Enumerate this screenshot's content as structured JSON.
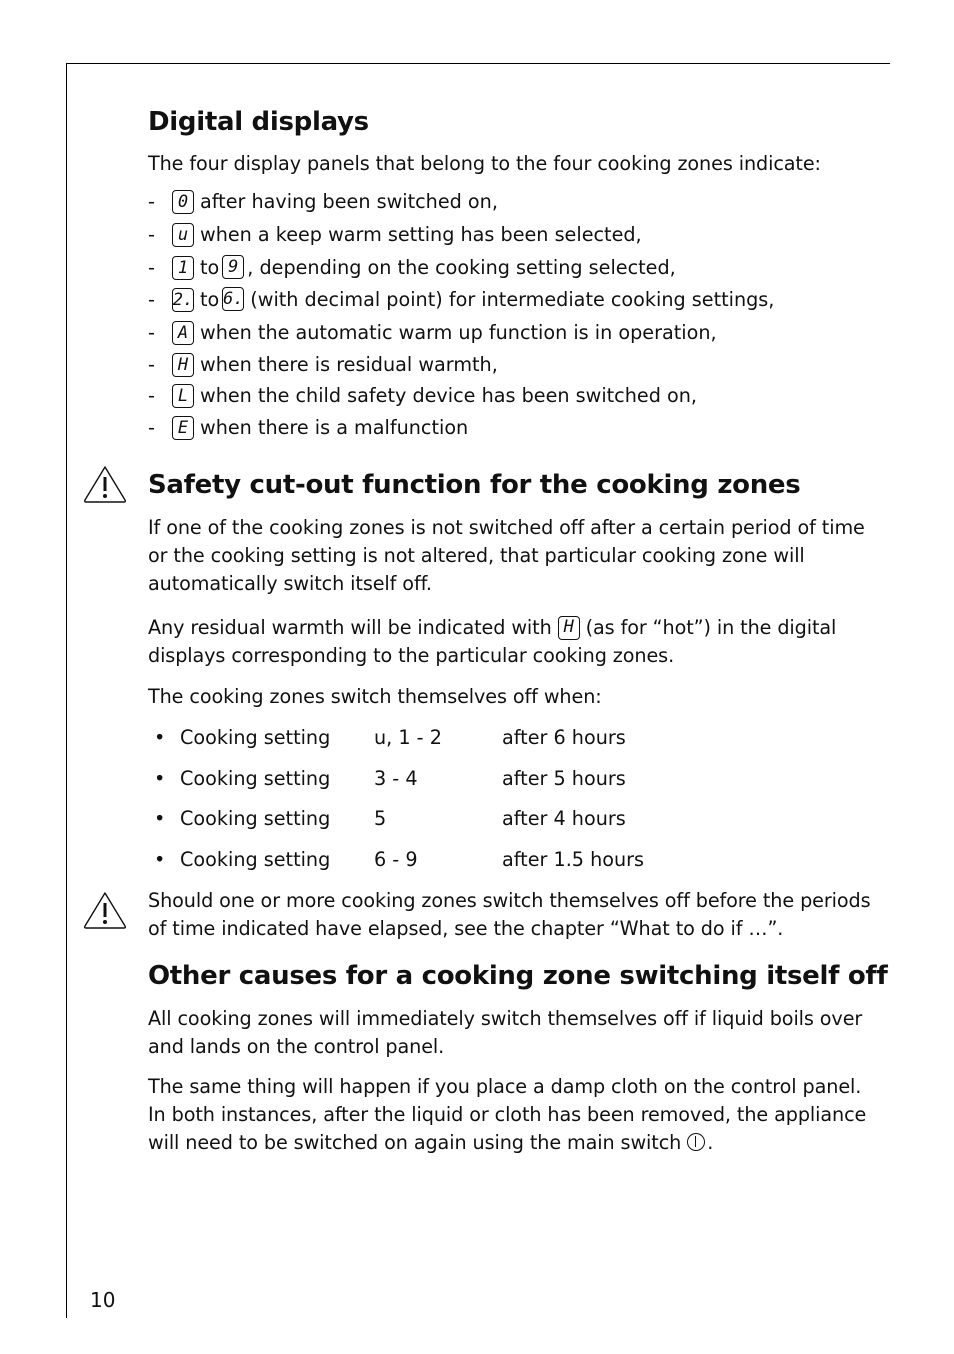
{
  "page_number": "10",
  "sections": {
    "digital_displays": {
      "heading": "Digital displays",
      "intro": "The four display panels that belong to the four cooking zones indicate:",
      "items": [
        {
          "dash": "-",
          "symbols": [
            "0"
          ],
          "text": "after having been switched on,"
        },
        {
          "dash": "-",
          "symbols": [
            "u"
          ],
          "text": "when a keep warm setting has been selected,"
        },
        {
          "dash": "-",
          "symbols": [
            "1",
            "9"
          ],
          "connector": "to",
          "text": ", depending on the cooking setting selected,"
        },
        {
          "dash": "-",
          "symbols": [
            "2.",
            "6."
          ],
          "connector": "to",
          "text": "(with decimal point) for intermediate cooking settings,"
        },
        {
          "dash": "-",
          "symbols": [
            "A"
          ],
          "text": "when the automatic warm up function is in operation,"
        },
        {
          "dash": "-",
          "symbols": [
            "H"
          ],
          "text": "when there is residual warmth,"
        },
        {
          "dash": "-",
          "symbols": [
            "L"
          ],
          "text": "when the child safety device has been switched on,"
        },
        {
          "dash": "-",
          "symbols": [
            "E"
          ],
          "text": "when there is a malfunction"
        }
      ]
    },
    "safety_cutout": {
      "icon": "warning-triangle-icon",
      "heading": "Safety cut-out function for the cooking zones",
      "para1": "If one of the cooking zones is not switched off after a certain period of time or the cooking setting is not altered, that particular cooking zone will automatically switch itself off.",
      "para2_before": "Any residual warmth will be indicated with",
      "para2_symbol": "H",
      "para2_after": "(as for “hot”) in the digital displays corresponding to the particular cooking zones.",
      "para3": "The cooking zones switch themselves off when:",
      "table": [
        {
          "label": "Cooking setting",
          "setting": "u, 1 - 2",
          "time": "after 6 hours"
        },
        {
          "label": "Cooking setting",
          "setting": "3 - 4",
          "time": "after 5 hours"
        },
        {
          "label": "Cooking setting",
          "setting": "5",
          "time": "after 4 hours"
        },
        {
          "label": "Cooking setting",
          "setting": "6 - 9",
          "time": "after 1.5 hours"
        }
      ],
      "warning_note": "Should one or more cooking zones switch themselves off before the periods of time indicated have elapsed, see the chapter “What to do if …”."
    },
    "other_causes": {
      "heading": "Other causes for a cooking zone switching itself off",
      "para1": "All cooking zones will immediately switch themselves off if liquid boils over and lands on the control panel.",
      "para2": "The same thing will happen if you place a damp cloth on the control panel. In both instances, after the liquid or cloth has been removed, the appliance will need to be switched on again using the main switch",
      "para2_end": ".",
      "power_icon": "power-switch-icon"
    }
  }
}
